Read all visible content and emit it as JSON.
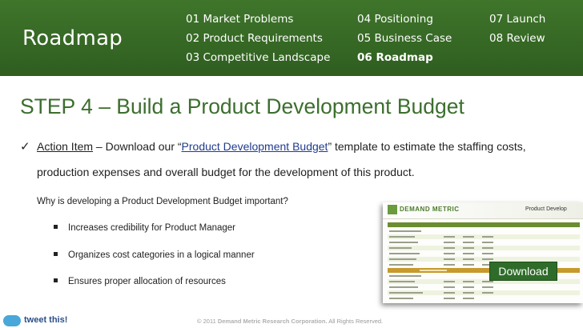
{
  "header": {
    "brand": "Roadmap",
    "nav": [
      {
        "label": "01 Market Problems",
        "active": false
      },
      {
        "label": "02 Product Requirements",
        "active": false
      },
      {
        "label": "03 Competitive Landscape",
        "active": false
      },
      {
        "label": "04 Positioning",
        "active": false
      },
      {
        "label": "05 Business Case",
        "active": false
      },
      {
        "label": "06 Roadmap",
        "active": true
      },
      {
        "label": "07 Launch",
        "active": false
      },
      {
        "label": "08 Review",
        "active": false
      }
    ],
    "colors": {
      "header_bg": "#3a6f28",
      "title": "#3c6f2e"
    }
  },
  "main": {
    "title": "STEP 4 – Build a Product Development Budget",
    "action": {
      "check_icon": "check-icon",
      "label": "Action Item",
      "text_before_link": " – Download our “",
      "link": "Product Development Budget",
      "text_after_link": "” template to estimate the staffing costs,",
      "line2": "production expenses and overall budget for the development of this product."
    },
    "why_heading": "Why is developing a Product Development Budget important?",
    "bullets": [
      "Increases credibility for Product Manager",
      "Organizes cost categories in a logical manner",
      "Ensures proper allocation of resources"
    ]
  },
  "preview": {
    "logo_text": "DEMAND METRIC",
    "doc_title": "Product Develop",
    "download_label": "Download"
  },
  "footer": {
    "tweet_label": "tweet this!",
    "copyright_prefix": "© 2011 ",
    "company": "Demand Metric Research Corporation.",
    "rights": " All Rights Reserved."
  }
}
